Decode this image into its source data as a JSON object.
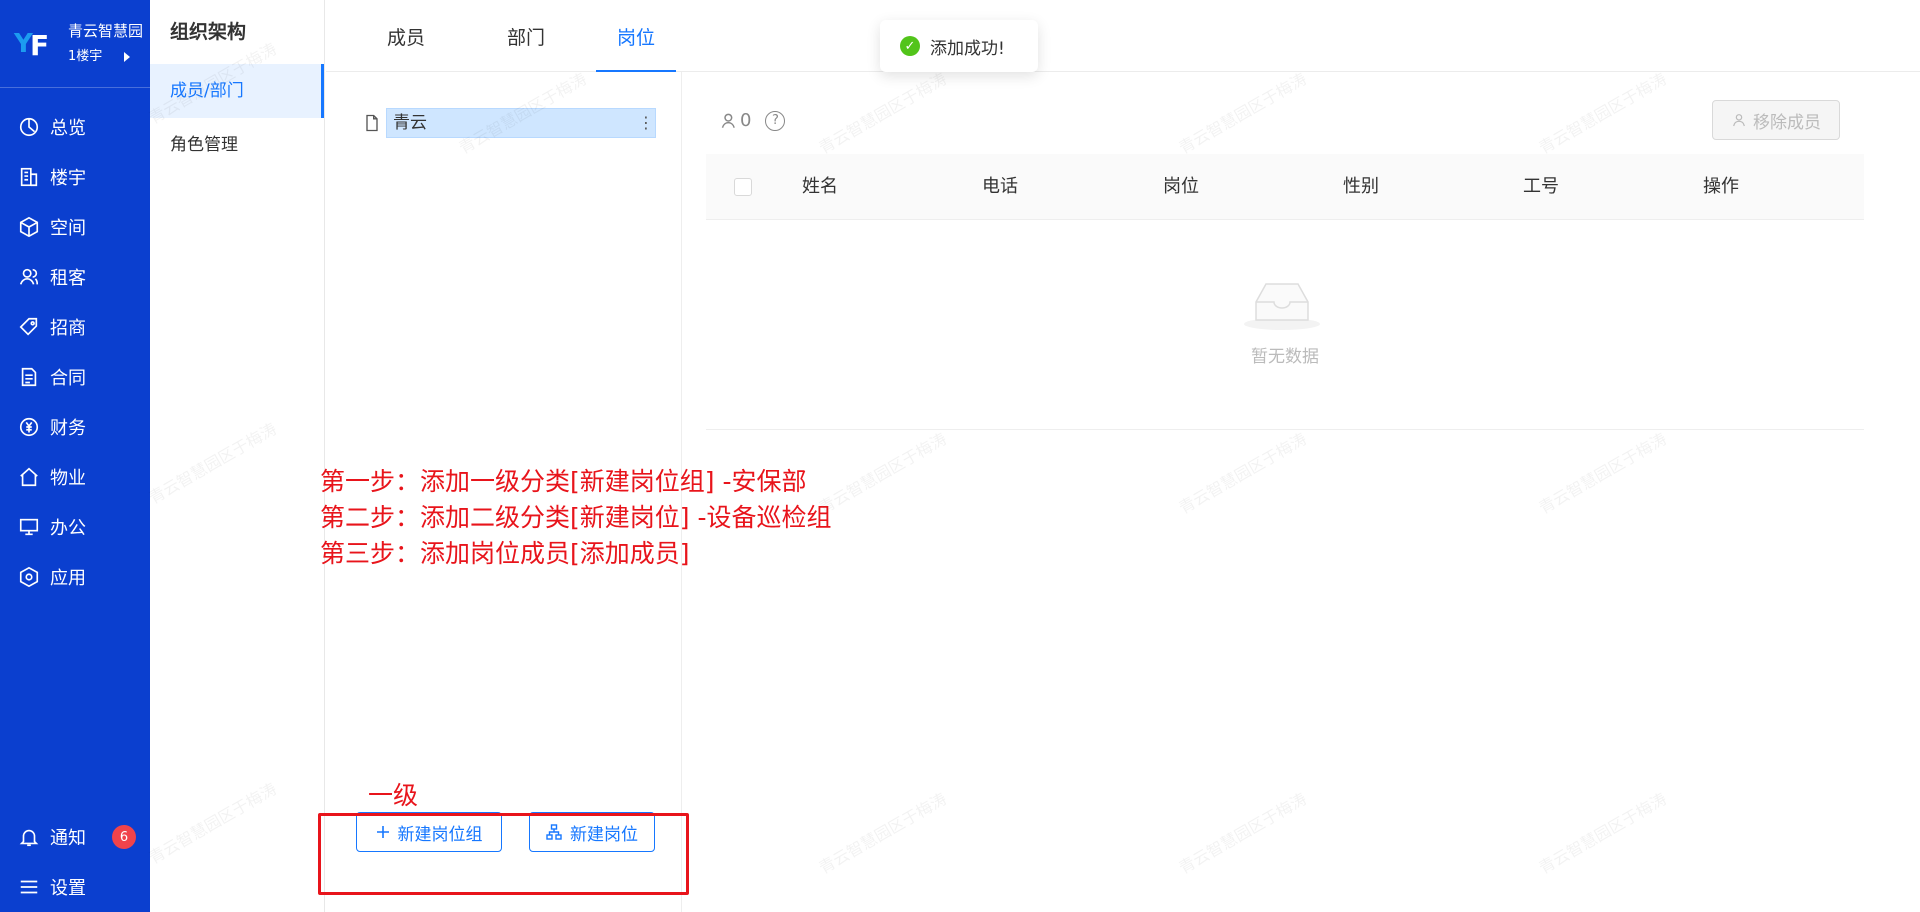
{
  "brand": {
    "name": "青云智慧园",
    "building": "1楼宇"
  },
  "nav": {
    "items": [
      {
        "label": "总览",
        "icon": "pie-chart-icon"
      },
      {
        "label": "楼宇",
        "icon": "building-icon"
      },
      {
        "label": "空间",
        "icon": "cube-icon"
      },
      {
        "label": "租客",
        "icon": "users-icon"
      },
      {
        "label": "招商",
        "icon": "tag-icon"
      },
      {
        "label": "合同",
        "icon": "document-icon"
      },
      {
        "label": "财务",
        "icon": "yen-icon"
      },
      {
        "label": "物业",
        "icon": "home-icon"
      },
      {
        "label": "办公",
        "icon": "monitor-icon"
      },
      {
        "label": "应用",
        "icon": "box-icon"
      }
    ],
    "notify": {
      "label": "通知",
      "badge": "6"
    },
    "settings": {
      "label": "设置"
    }
  },
  "submenu": {
    "title": "组织架构",
    "items": [
      {
        "label": "成员/部门"
      },
      {
        "label": "角色管理"
      }
    ]
  },
  "tabs": [
    {
      "label": "成员"
    },
    {
      "label": "部门"
    },
    {
      "label": "岗位"
    }
  ],
  "toast": {
    "message": "添加成功!"
  },
  "tree": {
    "root_label": "青云",
    "more": "⋮"
  },
  "buttons": {
    "new_group": "新建岗位组",
    "new_post": "新建岗位"
  },
  "members": {
    "count": "0",
    "help": "?",
    "remove_label": "移除成员",
    "columns": [
      "姓名",
      "电话",
      "岗位",
      "性别",
      "工号",
      "操作"
    ],
    "empty_text": "暂无数据"
  },
  "annotations": {
    "step1": "第一步：添加一级分类[新建岗位组] -安保部",
    "step2": "第二步：添加二级分类[新建岗位] -设备巡检组",
    "step3": "第三步：添加岗位成员[添加成员]",
    "level": "一级"
  },
  "watermark": "青云智慧园区于梅涛",
  "colors": {
    "nav_bg": "#0b3fcf",
    "primary": "#1677ff",
    "annotation": "#e8141b",
    "success": "#52c41a"
  }
}
